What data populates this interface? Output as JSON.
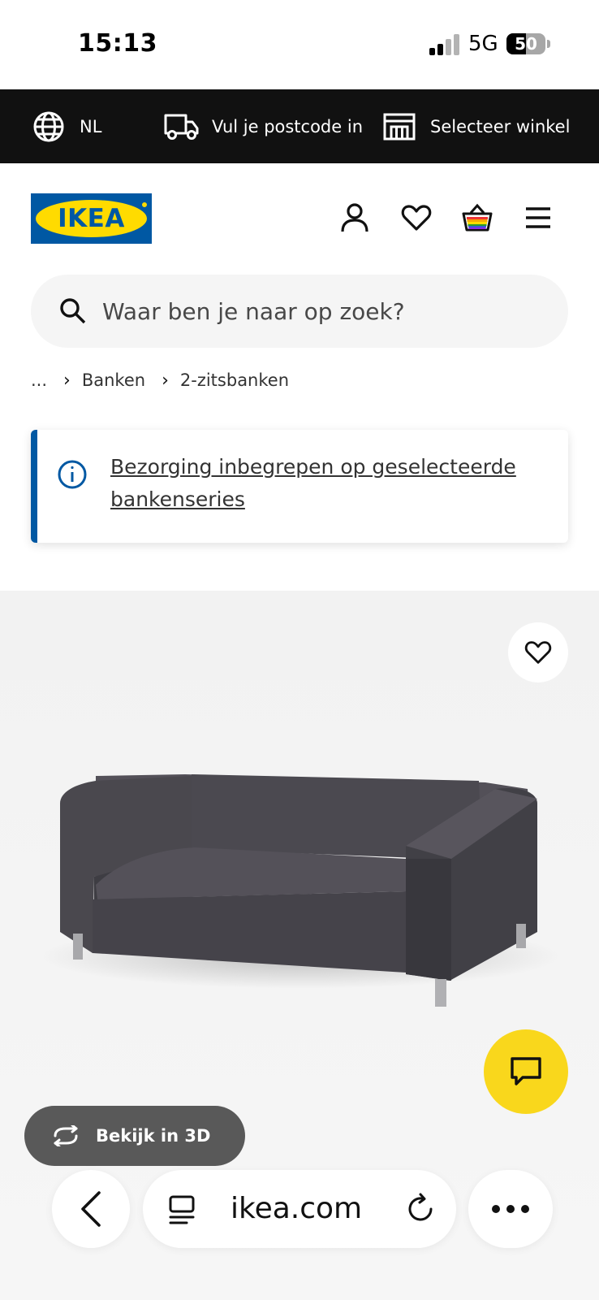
{
  "status_bar": {
    "time": "15:13",
    "network": "5G",
    "battery": "50",
    "battery_level": 0.5,
    "signal_bars": 2
  },
  "top_bar": {
    "language": {
      "label": "NL",
      "icon": "globe-icon"
    },
    "postcode": {
      "label": "Vul je postcode in",
      "icon": "delivery-truck-icon"
    },
    "store": {
      "label": "Selecteer winkel",
      "icon": "store-icon"
    }
  },
  "header": {
    "logo_text": "IKEA",
    "icons": [
      "user-icon",
      "heart-icon",
      "shopping-bag-icon",
      "menu-icon"
    ]
  },
  "search": {
    "placeholder": "Waar ben je naar op zoek?"
  },
  "breadcrumb": [
    "...",
    "Banken",
    "2-zitsbanken"
  ],
  "notice": {
    "text": "Bezorging inbegrepen op geselecteerde bankenseries",
    "icon": "info-icon"
  },
  "product": {
    "image": "grey-two-seat-sofa",
    "view_3d_label": "Bekijk in 3D"
  },
  "browser": {
    "url": "ikea.com"
  },
  "colors": {
    "ikea_blue": "#0058a3",
    "ikea_yellow": "#ffdb00",
    "chat_yellow": "#f9d71c",
    "top_bar_bg": "#111111"
  }
}
